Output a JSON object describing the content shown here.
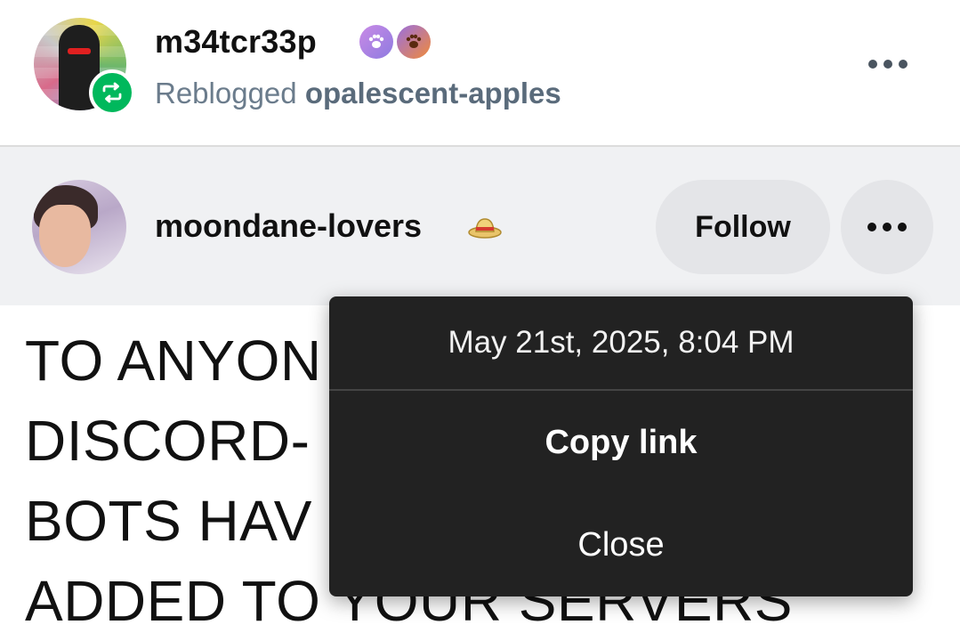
{
  "reblog": {
    "username": "m34tcr33p",
    "reblogged_prefix": "Reblogged",
    "reblogged_from": "opalescent-apples"
  },
  "post": {
    "author": "moondane-lovers",
    "follow_label": "Follow",
    "body_lines": [
      "TO ANYON",
      "DISCORD-",
      "BOTS HAV",
      "ADDED TO YOUR SERVERS"
    ]
  },
  "popup": {
    "timestamp": "May 21st, 2025, 8:04 PM",
    "copy_link_label": "Copy link",
    "close_label": "Close"
  },
  "icons": {
    "reblog": "reblog-icon",
    "badge_1": "paw-badge-icon",
    "badge_2": "paw-badge-icon",
    "hat": "straw-hat-icon",
    "more": "more-options-icon"
  },
  "colors": {
    "reblog_green": "#00b85c",
    "popup_bg": "#222222",
    "header_bg": "#f0f1f3",
    "muted_text": "#6b7c8c"
  }
}
